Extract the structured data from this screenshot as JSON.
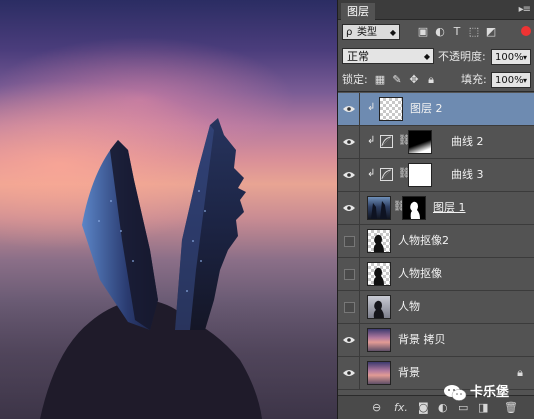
{
  "panel": {
    "tab_label": "图层",
    "kind_filter": {
      "icon": "search-icon",
      "selected": "类型"
    },
    "filter_icons": [
      "image-filter-icon",
      "adjustment-filter-icon",
      "type-filter-icon",
      "shape-filter-icon",
      "smart-object-filter-icon"
    ],
    "blend_mode": "正常",
    "opacity_label": "不透明度:",
    "opacity_value": "100%",
    "lock_label": "锁定:",
    "fill_label": "填充:",
    "fill_value": "100%"
  },
  "layers": [
    {
      "name": "图层 2",
      "visible": true,
      "selected": true,
      "clipped": true,
      "thumb": "transparent"
    },
    {
      "name": "曲线 2",
      "visible": true,
      "clipped": true,
      "thumb": "curves-adjustment",
      "mask": "gradient-black-white"
    },
    {
      "name": "曲线 3",
      "visible": true,
      "clipped": true,
      "thumb": "curves-adjustment",
      "mask": "white"
    },
    {
      "name": "图层 1",
      "visible": true,
      "thumb": "city-photo",
      "mask": "silhouette"
    },
    {
      "name": "人物抠像2",
      "visible": false,
      "thumb": "silhouette-transparent"
    },
    {
      "name": "人物抠像",
      "visible": false,
      "thumb": "silhouette-transparent"
    },
    {
      "name": "人物",
      "visible": false,
      "thumb": "person-photo"
    },
    {
      "name": "背景 拷贝",
      "visible": true,
      "thumb": "sunset-photo"
    },
    {
      "name": "背景",
      "visible": true,
      "thumb": "sunset-photo",
      "locked": true
    }
  ],
  "bottom_icons": [
    "link-layers-icon",
    "fx-icon",
    "add-mask-icon",
    "new-adjustment-icon",
    "new-group-icon",
    "new-layer-icon",
    "delete-icon"
  ],
  "bottom_fx_label": "fx.",
  "watermark": {
    "text": "卡乐堡"
  },
  "colors": {
    "selection": "#6e8bb1",
    "panel_bg": "#535353"
  }
}
